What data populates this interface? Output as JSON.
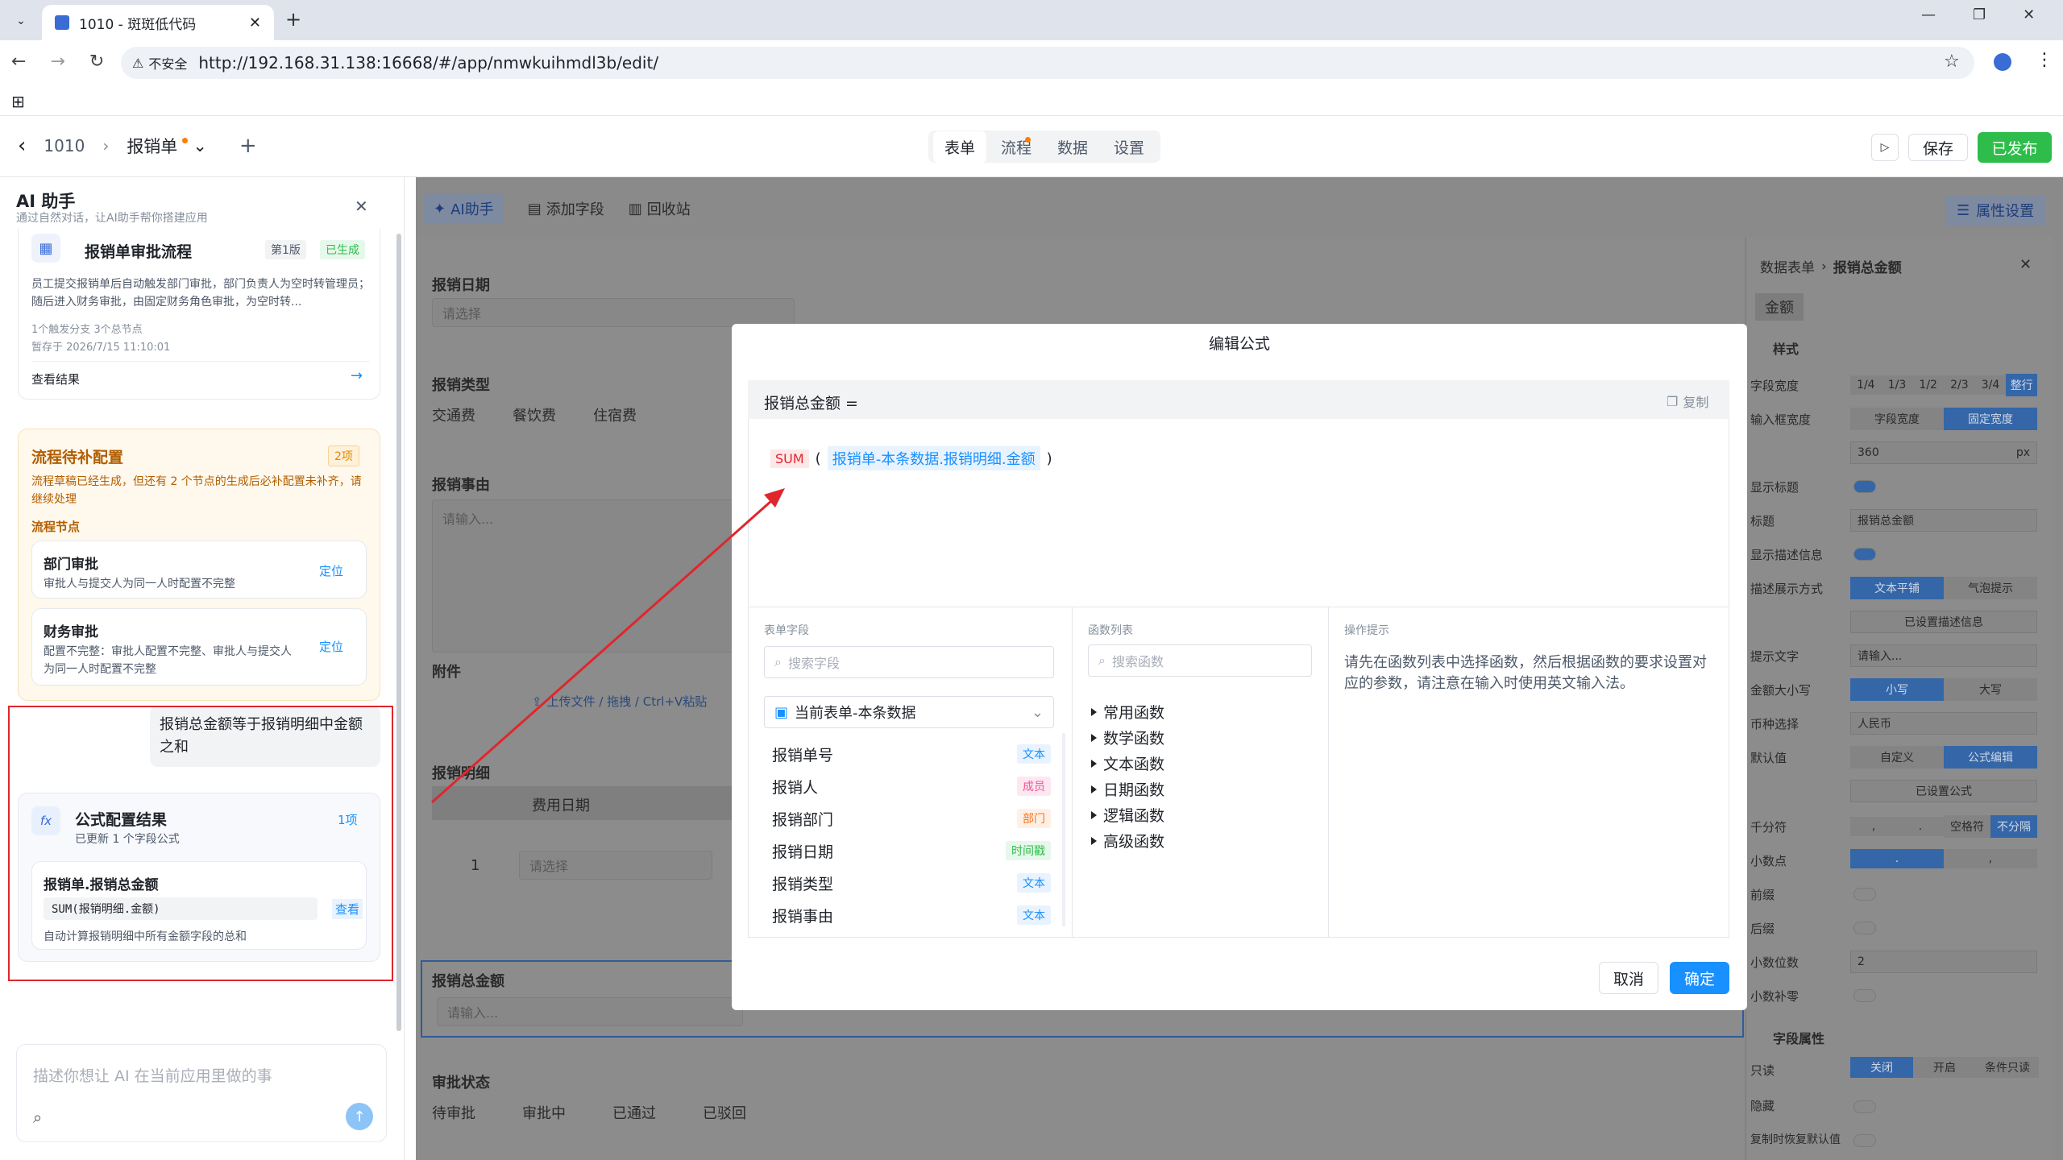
{
  "browser": {
    "tab_title": "1010 - 斑斑低代码",
    "insecure": "不安全",
    "url": "http://192.168.31.138:16668/#/app/nmwkuihmdl3b/edit/"
  },
  "header": {
    "breadcrumb_root": "1010",
    "form_name": "报销单",
    "tabs": [
      "表单",
      "流程",
      "数据",
      "设置"
    ],
    "save": "保存",
    "publish": "已发布"
  },
  "ai": {
    "title": "AI 助手",
    "subtitle": "通过自然对话，让AI助手帮你搭建应用",
    "flow_card": {
      "title": "报销单审批流程",
      "version": "第1版",
      "status": "已生成",
      "desc": "员工提交报销单后自动触发部门审批，部门负责人为空时转管理员；随后进入财务审批，由固定财务角色审批，为空时转...",
      "meta1": "1个触发分支  3个总节点",
      "meta2": "暂存于 2026/7/15 11:10:01",
      "link": "查看结果"
    },
    "pending": {
      "title": "流程待补配置",
      "count": "2项",
      "desc": "流程草稿已经生成，但还有 2 个节点的生成后必补配置未补齐，请继续处理",
      "section": "流程节点",
      "nodes": [
        {
          "name": "部门审批",
          "desc": "审批人与提交人为同一人时配置不完整",
          "action": "定位"
        },
        {
          "name": "财务审批",
          "desc": "配置不完整：审批人配置不完整、审批人与提交人为同一人时配置不完整",
          "action": "定位"
        }
      ]
    },
    "user_msg": "报销总金额等于报销明细中金额之和",
    "result": {
      "title": "公式配置结果",
      "sub": "已更新 1 个字段公式",
      "count": "1项",
      "field": "报销单.报销总金额",
      "formula": "SUM(报销明细.金额)",
      "view": "查看",
      "desc": "自动计算报销明细中所有金额字段的总和"
    },
    "input_placeholder": "描述你想让 AI 在当前应用里做的事"
  },
  "toolbar": {
    "ai": "AI助手",
    "add_field": "添加字段",
    "recycle": "回收站",
    "props": "属性设置"
  },
  "form": {
    "date_label": "报销日期",
    "date_placeholder": "请选择",
    "type_label": "报销类型",
    "type_options": [
      "交通费",
      "餐饮费",
      "住宿费"
    ],
    "reason_label": "报销事由",
    "reason_placeholder": "请输入...",
    "attach_label": "附件",
    "attach_text": "上传文件 / 拖拽 / Ctrl+V粘贴",
    "detail_label": "报销明细",
    "detail_col": "费用日期",
    "row_no": "1",
    "row_placeholder": "请选择",
    "total_label": "报销总金额",
    "total_placeholder": "请输入...",
    "status_label": "审批状态",
    "status_options": [
      "待审批",
      "审批中",
      "已通过",
      "已驳回"
    ]
  },
  "props": {
    "crumb1": "数据表单",
    "crumb2": "报销总金额",
    "type": "金额",
    "style_section": "样式",
    "rows": [
      {
        "label": "字段宽度",
        "opts": [
          "1/4",
          "1/3",
          "1/2",
          "2/3",
          "3/4",
          "整行"
        ]
      },
      {
        "label": "输入框宽度",
        "opts": [
          "字段宽度",
          "固定宽度"
        ]
      },
      {
        "label": "",
        "value": "360",
        "unit": "px"
      },
      {
        "label": "显示标题"
      },
      {
        "label": "标题",
        "value": "报销总金额"
      },
      {
        "label": "显示描述信息"
      },
      {
        "label": "描述展示方式",
        "opts": [
          "文本平铺",
          "气泡提示"
        ]
      },
      {
        "label": "",
        "value": "已设置描述信息"
      },
      {
        "label": "提示文字",
        "value": "请输入..."
      },
      {
        "label": "金额大小写",
        "opts": [
          "小写",
          "大写"
        ]
      },
      {
        "label": "币种选择",
        "value": "人民币"
      },
      {
        "label": "默认值",
        "opts": [
          "自定义",
          "公式编辑"
        ]
      },
      {
        "label": "",
        "value": "已设置公式"
      },
      {
        "label": "千分符",
        "opts": [
          ",",
          ".",
          "空格符",
          "不分隔"
        ]
      },
      {
        "label": "小数点",
        "opts": [
          ".",
          ","
        ]
      },
      {
        "label": "前缀"
      },
      {
        "label": "后缀"
      },
      {
        "label": "小数位数",
        "value": "2"
      },
      {
        "label": "小数补零"
      }
    ],
    "attr_section": "字段属性",
    "readonly_label": "只读",
    "readonly_opts": [
      "关闭",
      "开启",
      "条件只读"
    ],
    "hidden_label": "隐藏",
    "reset_label": "复制时恢复默认值"
  },
  "modal": {
    "title": "编辑公式",
    "target": "报销总金额 =",
    "copy": "复制",
    "func": "SUM",
    "arg": "报销单-本条数据.报销明细.金额",
    "fields_title": "表单字段",
    "fields_search": "搜索字段",
    "fields_source": "当前表单-本条数据",
    "fields": [
      {
        "name": "报销单号",
        "tag": "文本",
        "color": "#1890ff",
        "bg": "#e8f3ff"
      },
      {
        "name": "报销人",
        "tag": "成员",
        "color": "#f0509a",
        "bg": "#fde8f2"
      },
      {
        "name": "报销部门",
        "tag": "部门",
        "color": "#f5731c",
        "bg": "#fff0e6"
      },
      {
        "name": "报销日期",
        "tag": "时间戳",
        "color": "#2ebd4a",
        "bg": "#e6f8eb"
      },
      {
        "name": "报销类型",
        "tag": "文本",
        "color": "#1890ff",
        "bg": "#e8f3ff"
      },
      {
        "name": "报销事由",
        "tag": "文本",
        "color": "#1890ff",
        "bg": "#e8f3ff"
      }
    ],
    "funcs_title": "函数列表",
    "funcs_search": "搜索函数",
    "funcs": [
      "常用函数",
      "数学函数",
      "文本函数",
      "日期函数",
      "逻辑函数",
      "高级函数"
    ],
    "tips_title": "操作提示",
    "tips": "请先在函数列表中选择函数，然后根据函数的要求设置对应的参数，请注意在输入时使用英文输入法。",
    "cancel": "取消",
    "ok": "确定"
  },
  "colors": {
    "primary": "#1890ff",
    "published": "#2ebd4a",
    "annotation": "#e0262d"
  }
}
